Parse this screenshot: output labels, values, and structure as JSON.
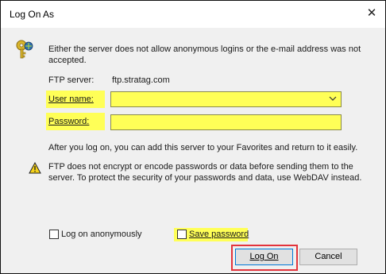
{
  "window": {
    "title": "Log On As",
    "close_glyph": "✕"
  },
  "message": "Either the server does not allow anonymous logins or the e-mail address was not accepted.",
  "ftp_server": {
    "label": "FTP server:",
    "value": "ftp.stratag.com"
  },
  "user_name": {
    "label": "User name:",
    "value": "",
    "icon": "chevron-down-icon"
  },
  "password": {
    "label": "Password:",
    "value": ""
  },
  "after_logon_text": "After you log on, you can add this server to your Favorites and return to it easily.",
  "warning_text": "FTP does not encrypt or encode passwords or data before sending them to the server.  To protect the security of your passwords and data, use WebDAV instead.",
  "anonymous": {
    "label": "Log on anonymously",
    "checked": false
  },
  "save_password": {
    "label": "Save password",
    "checked": false
  },
  "buttons": {
    "logon": "Log On",
    "cancel": "Cancel"
  },
  "colors": {
    "highlight": "#ffff57",
    "annotation_frame": "#e3343c",
    "focus_border": "#0078d7"
  }
}
